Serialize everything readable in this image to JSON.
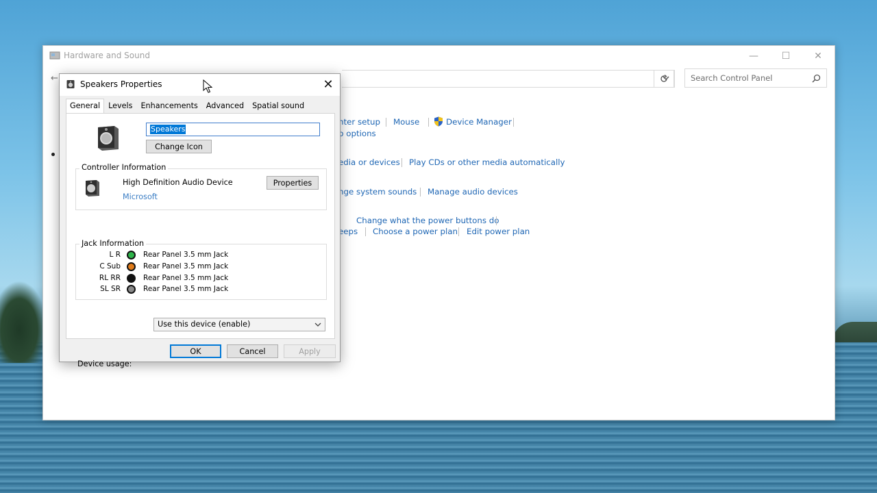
{
  "window": {
    "title": "Hardware and Sound",
    "minimize": "—",
    "maximize": "☐",
    "close": "✕",
    "search_placeholder": "Search Control Panel"
  },
  "control_panel": {
    "row1": {
      "link1": "nter setup",
      "link2": "Mouse",
      "link3": "Device Manager",
      "link4": "p options"
    },
    "row2": {
      "link1": "edia or devices",
      "link2": "Play CDs or other media automatically"
    },
    "row3": {
      "link1": "nge system sounds",
      "link2": "Manage audio devices"
    },
    "row4": {
      "link1": "Change what the power buttons do",
      "link2": "eeps",
      "link3": "Choose a power plan",
      "link4": "Edit power plan"
    }
  },
  "dialog": {
    "title": "Speakers Properties",
    "close": "✕",
    "tabs": [
      "General",
      "Levels",
      "Enhancements",
      "Advanced",
      "Spatial sound"
    ],
    "active_tab": "General",
    "device_name": "Speakers",
    "change_icon": "Change Icon",
    "controller_group": "Controller Information",
    "controller_name": "High Definition Audio Device",
    "controller_maker": "Microsoft",
    "properties_button": "Properties",
    "jack_group": "Jack Information",
    "jacks": [
      {
        "label": "L R",
        "description": "Rear Panel 3.5 mm Jack",
        "color": "#2db34a"
      },
      {
        "label": "C Sub",
        "description": "Rear Panel 3.5 mm Jack",
        "color": "#e07b1a"
      },
      {
        "label": "RL RR",
        "description": "Rear Panel 3.5 mm Jack",
        "color": "#111111"
      },
      {
        "label": "SL SR",
        "description": "Rear Panel 3.5 mm Jack",
        "color": "#8a8a8a"
      }
    ],
    "device_usage_label": "Device usage:",
    "device_usage_value": "Use this device (enable)",
    "ok": "OK",
    "cancel": "Cancel",
    "apply": "Apply"
  },
  "colors": {
    "link": "#1e66b4",
    "selection": "#0078d7",
    "ok_border": "#0078d7"
  }
}
